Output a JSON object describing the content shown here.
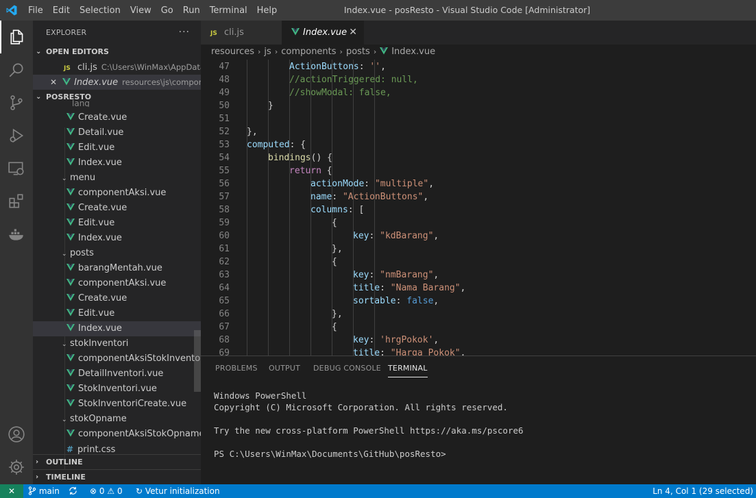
{
  "titlebar": {
    "menus": [
      "File",
      "Edit",
      "Selection",
      "View",
      "Go",
      "Run",
      "Terminal",
      "Help"
    ],
    "title": "Index.vue - posResto - Visual Studio Code [Administrator]"
  },
  "activitybar": {
    "icons": [
      "explorer-icon",
      "search-icon",
      "source-control-icon",
      "run-debug-icon",
      "remote-explorer-icon",
      "extensions-icon",
      "docker-icon",
      "account-icon",
      "settings-gear-icon"
    ]
  },
  "sidebar": {
    "header": "EXPLORER",
    "more": "···",
    "open_editors": {
      "title": "OPEN EDITORS",
      "items": [
        {
          "icon": "JS",
          "name": "cli.js",
          "path": "C:\\Users\\WinMax\\AppData..."
        },
        {
          "close": "✕",
          "name": "Index.vue",
          "path": "resources\\js\\compone..."
        }
      ]
    },
    "project": {
      "title": "POSRESTO",
      "partial_folder": "lang",
      "tree": [
        {
          "type": "vue",
          "name": "Create.vue"
        },
        {
          "type": "vue",
          "name": "Detail.vue"
        },
        {
          "type": "vue",
          "name": "Edit.vue"
        },
        {
          "type": "vue",
          "name": "Index.vue"
        },
        {
          "type": "folder",
          "name": "menu"
        },
        {
          "type": "vue",
          "name": "componentAksi.vue"
        },
        {
          "type": "vue",
          "name": "Create.vue"
        },
        {
          "type": "vue",
          "name": "Edit.vue"
        },
        {
          "type": "vue",
          "name": "Index.vue"
        },
        {
          "type": "folder",
          "name": "posts"
        },
        {
          "type": "vue",
          "name": "barangMentah.vue"
        },
        {
          "type": "vue",
          "name": "componentAksi.vue"
        },
        {
          "type": "vue",
          "name": "Create.vue"
        },
        {
          "type": "vue",
          "name": "Edit.vue"
        },
        {
          "type": "vue",
          "name": "Index.vue"
        },
        {
          "type": "folder",
          "name": "stokInventori"
        },
        {
          "type": "vue",
          "name": "componentAksiStokInventori...."
        },
        {
          "type": "vue",
          "name": "DetailInventori.vue"
        },
        {
          "type": "vue",
          "name": "StokInventori.vue"
        },
        {
          "type": "vue",
          "name": "StokInventoriCreate.vue"
        },
        {
          "type": "folder",
          "name": "stokOpname"
        },
        {
          "type": "vue",
          "name": "componentAksiStokOpname...."
        },
        {
          "type": "css",
          "name": "print.css"
        }
      ]
    },
    "outline": "OUTLINE",
    "timeline": "TIMELINE"
  },
  "tabs": [
    {
      "icon": "JS",
      "label": "cli.js"
    },
    {
      "label": "Index.vue",
      "close": "✕"
    }
  ],
  "breadcrumbs": [
    "resources",
    "js",
    "components",
    "posts",
    "Index.vue"
  ],
  "editor": {
    "lines": [
      {
        "n": "47",
        "i": 2,
        "tokens": [
          [
            "p",
            "ActionButtons"
          ],
          [
            "u",
            ": "
          ],
          [
            "s",
            "''"
          ],
          [
            "u",
            ","
          ]
        ]
      },
      {
        "n": "48",
        "i": 2,
        "tokens": [
          [
            "c",
            "//actionTriggered: null,"
          ]
        ]
      },
      {
        "n": "49",
        "i": 2,
        "tokens": [
          [
            "c",
            "//showModal: false,"
          ]
        ]
      },
      {
        "n": "50",
        "i": 1,
        "tokens": [
          [
            "u",
            "}"
          ]
        ]
      },
      {
        "n": "51",
        "i": 0,
        "tokens": []
      },
      {
        "n": "52",
        "i": 0,
        "tokens": [
          [
            "u",
            "},"
          ]
        ]
      },
      {
        "n": "53",
        "i": 0,
        "tokens": [
          [
            "p",
            "computed"
          ],
          [
            "u",
            ": {"
          ]
        ]
      },
      {
        "n": "54",
        "i": 1,
        "tokens": [
          [
            "f",
            "bindings"
          ],
          [
            "u",
            "() {"
          ]
        ]
      },
      {
        "n": "55",
        "i": 2,
        "tokens": [
          [
            "k",
            "return"
          ],
          [
            "u",
            " {"
          ]
        ]
      },
      {
        "n": "56",
        "i": 3,
        "tokens": [
          [
            "p",
            "actionMode"
          ],
          [
            "u",
            ": "
          ],
          [
            "s",
            "\"multiple\""
          ],
          [
            "u",
            ","
          ]
        ]
      },
      {
        "n": "57",
        "i": 3,
        "tokens": [
          [
            "p",
            "name"
          ],
          [
            "u",
            ": "
          ],
          [
            "s",
            "\"ActionButtons\""
          ],
          [
            "u",
            ","
          ]
        ]
      },
      {
        "n": "58",
        "i": 3,
        "tokens": [
          [
            "p",
            "columns"
          ],
          [
            "u",
            ": ["
          ]
        ]
      },
      {
        "n": "59",
        "i": 4,
        "tokens": [
          [
            "u",
            "{"
          ]
        ]
      },
      {
        "n": "60",
        "i": 5,
        "tokens": [
          [
            "p",
            "key"
          ],
          [
            "u",
            ": "
          ],
          [
            "s",
            "\"kdBarang\""
          ],
          [
            "u",
            ","
          ]
        ]
      },
      {
        "n": "61",
        "i": 4,
        "tokens": [
          [
            "u",
            "},"
          ]
        ]
      },
      {
        "n": "62",
        "i": 4,
        "tokens": [
          [
            "u",
            "{"
          ]
        ]
      },
      {
        "n": "63",
        "i": 5,
        "tokens": [
          [
            "p",
            "key"
          ],
          [
            "u",
            ": "
          ],
          [
            "s",
            "\"nmBarang\""
          ],
          [
            "u",
            ","
          ]
        ]
      },
      {
        "n": "64",
        "i": 5,
        "tokens": [
          [
            "p",
            "title"
          ],
          [
            "u",
            ": "
          ],
          [
            "s",
            "\"Nama Barang\""
          ],
          [
            "u",
            ","
          ]
        ]
      },
      {
        "n": "65",
        "i": 5,
        "tokens": [
          [
            "p",
            "sortable"
          ],
          [
            "u",
            ": "
          ],
          [
            "b",
            "false"
          ],
          [
            "u",
            ","
          ]
        ]
      },
      {
        "n": "66",
        "i": 4,
        "tokens": [
          [
            "u",
            "},"
          ]
        ]
      },
      {
        "n": "67",
        "i": 4,
        "tokens": [
          [
            "u",
            "{"
          ]
        ]
      },
      {
        "n": "68",
        "i": 5,
        "tokens": [
          [
            "p",
            "key"
          ],
          [
            "u",
            ": "
          ],
          [
            "s",
            "'hrgPokok'"
          ],
          [
            "u",
            ","
          ]
        ]
      },
      {
        "n": "69",
        "i": 5,
        "tokens": [
          [
            "p",
            "title"
          ],
          [
            "u",
            ": "
          ],
          [
            "s",
            "\"Harga Pokok\""
          ],
          [
            "u",
            ","
          ]
        ]
      }
    ]
  },
  "panel": {
    "tabs": [
      "PROBLEMS",
      "OUTPUT",
      "DEBUG CONSOLE",
      "TERMINAL"
    ],
    "active_tab": "TERMINAL",
    "terminal": [
      "Windows PowerShell",
      "Copyright (C) Microsoft Corporation. All rights reserved.",
      "",
      "Try the new cross-platform PowerShell https://aka.ms/pscore6",
      "",
      "PS C:\\Users\\WinMax\\Documents\\GitHub\\posResto>"
    ]
  },
  "statusbar": {
    "remote": "✕",
    "branch": "main",
    "errors": "0",
    "warnings": "0",
    "vetur": "Vetur initialization",
    "position": "Ln 4, Col 1 (29 selected)"
  },
  "colors": {
    "accent": "#007acc",
    "vue_green": "#41b883",
    "js_yellow": "#cbcb41"
  }
}
